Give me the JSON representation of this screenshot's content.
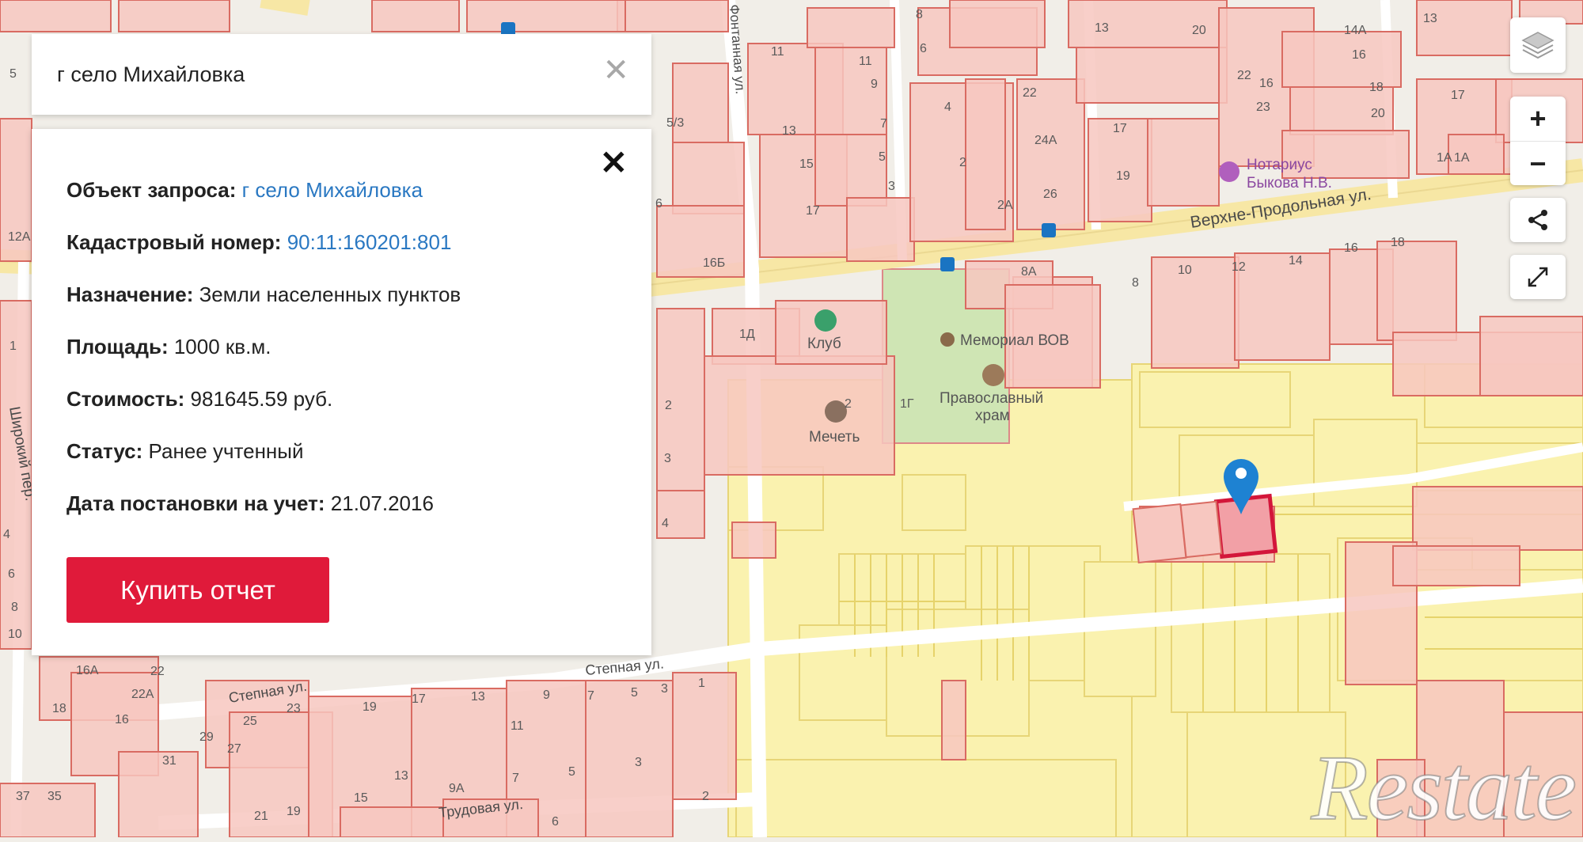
{
  "search": {
    "query": "г село Михайловка",
    "clear_glyph": "✕"
  },
  "panel": {
    "close_glyph": "✕",
    "rows": [
      {
        "label": "Объект запроса:",
        "value": "г село Михайловка",
        "is_link": true
      },
      {
        "label": "Кадастровый номер:",
        "value": "90:11:160201:801",
        "is_link": true
      },
      {
        "label": "Назначение:",
        "value": "Земли населенных пунктов",
        "is_link": false
      },
      {
        "label": "Площадь:",
        "value": "1000 кв.м.",
        "is_link": false
      },
      {
        "label": "Стоимость:",
        "value": "981645.59 руб.",
        "is_link": false
      },
      {
        "label": "Статус:",
        "value": "Ранее учтенный",
        "is_link": false
      },
      {
        "label": "Дата постановки на учет:",
        "value": "21.07.2016",
        "is_link": false
      }
    ],
    "buy_button_label": "Купить отчет"
  },
  "map": {
    "streets": {
      "verkhne": "Верхне-Продольная ул.",
      "stepnaya_right": "Степная ул.",
      "stepnaya_left": "Степная ул.",
      "trudovaya": "Трудовая ул.",
      "shirokiy": "Широкий пер.",
      "fontannaya": "Фонтанная ул."
    },
    "pois": {
      "notary_line1": "Нотариус",
      "notary_line2": "Быкова Н.В.",
      "memorial": "Мемориал ВОВ",
      "club": "Клуб",
      "church_line1": "Православный",
      "church_line2": "храм",
      "mosque": "Мечеть"
    },
    "house_numbers": {
      "n1": "8",
      "n2": "6",
      "n3": "13",
      "n4": "20",
      "n5": "14А",
      "n6": "16",
      "n7": "13",
      "n8": "22",
      "n9": "18",
      "n10": "20",
      "n11": "17",
      "n12": "1А",
      "n13": "11",
      "n14": "13",
      "n15": "15",
      "n16": "17",
      "n17": "11",
      "n18": "9",
      "n19": "7",
      "n20": "5",
      "n21": "3",
      "n22": "2",
      "n23": "4",
      "n24": "22",
      "n25": "24А",
      "n26": "26",
      "n27": "2А",
      "n28": "17",
      "n29": "19",
      "n30": "23",
      "n31": "16",
      "n32": "16Б",
      "n33": "8А",
      "n34": "8",
      "n35": "10",
      "n36": "12",
      "n37": "14",
      "n38": "16",
      "n39": "18",
      "n40": "1Д",
      "n41": "1Г",
      "n42": "2",
      "n43": "3",
      "n44": "4",
      "n45": "5/3",
      "n46": "6",
      "n47": "5",
      "n48": "12А",
      "n49": "1",
      "n50": "4",
      "n51": "6",
      "n52": "8",
      "n53": "10",
      "n54": "16А",
      "n55": "22",
      "n56": "22А",
      "n57": "16",
      "n58": "18",
      "n59": "29",
      "n60": "27",
      "n61": "25",
      "n62": "23",
      "n63": "19",
      "n64": "17",
      "n65": "13",
      "n66": "9",
      "n67": "7",
      "n68": "5",
      "n69": "3",
      "n70": "1",
      "n71": "11",
      "n72": "3",
      "n73": "31",
      "n74": "37",
      "n75": "35",
      "n76": "21",
      "n77": "19",
      "n78": "15",
      "n79": "9А",
      "n80": "7",
      "n81": "13",
      "n82": "6",
      "n83": "2",
      "n84": "5",
      "n85": "2",
      "n86": "1А"
    }
  },
  "controls": {
    "zoom_in": "+",
    "zoom_out": "−"
  },
  "watermark": "Restate"
}
